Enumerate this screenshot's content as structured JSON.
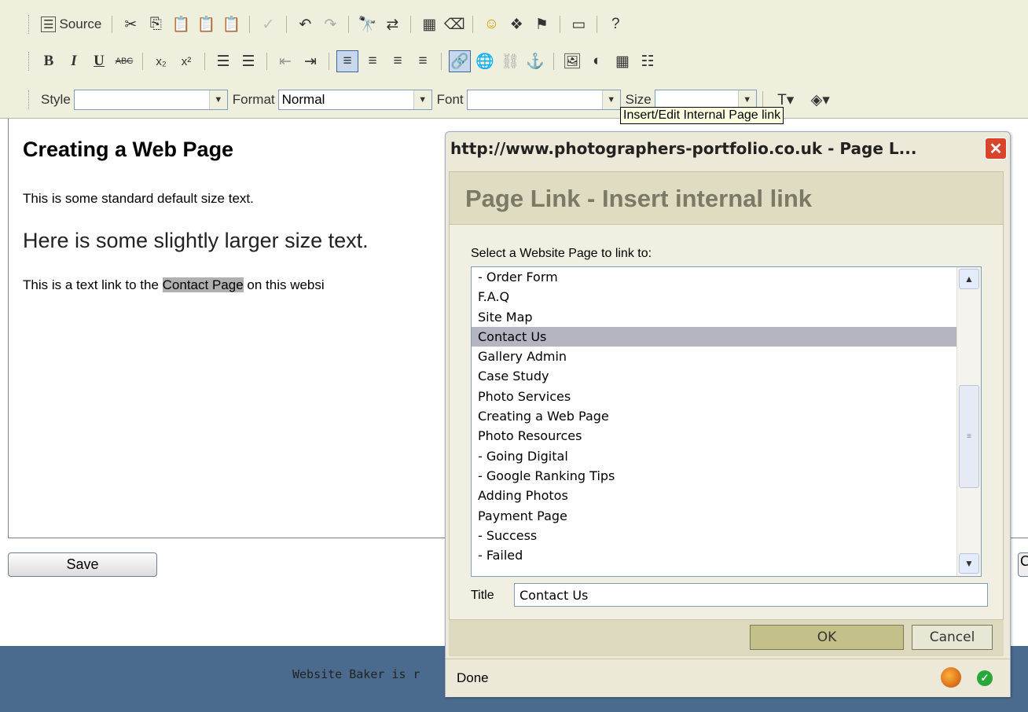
{
  "toolbar": {
    "source_label": "Source",
    "style_label": "Style",
    "style_value": "",
    "format_label": "Format",
    "format_value": "Normal",
    "font_label": "Font",
    "font_value": "",
    "size_label": "Size",
    "size_value": "",
    "bold": "B",
    "italic": "I",
    "underline": "U",
    "strike": "ABC",
    "tooltip": "Insert/Edit Internal Page link"
  },
  "editor": {
    "heading": "Creating a Web Page",
    "para1": "This is some standard default size text.",
    "para2": "Here is some slightly larger size text.",
    "para3_before": "This is a text link to the ",
    "para3_link": "Contact Page",
    "para3_after": " on this websi"
  },
  "save_label": "Save",
  "close_fragment": "C",
  "footer_text": "Website Baker is r",
  "dialog": {
    "window_title": "http://www.photographers-portfolio.co.uk - Page L...",
    "header": "Page Link - Insert internal link",
    "select_label": "Select a Website Page to link to:",
    "pages": [
      "- Order Form",
      "F.A.Q",
      "Site Map",
      "Contact Us",
      "Gallery Admin",
      "Case Study",
      "Photo Services",
      "Creating a Web Page",
      "Photo Resources",
      "- Going Digital",
      "- Google Ranking Tips",
      "Adding Photos",
      "Payment Page",
      "- Success",
      "- Failed"
    ],
    "selected_page": "Contact Us",
    "title_label": "Title",
    "title_value": "Contact Us",
    "ok_label": "OK",
    "cancel_label": "Cancel",
    "status_text": "Done"
  }
}
